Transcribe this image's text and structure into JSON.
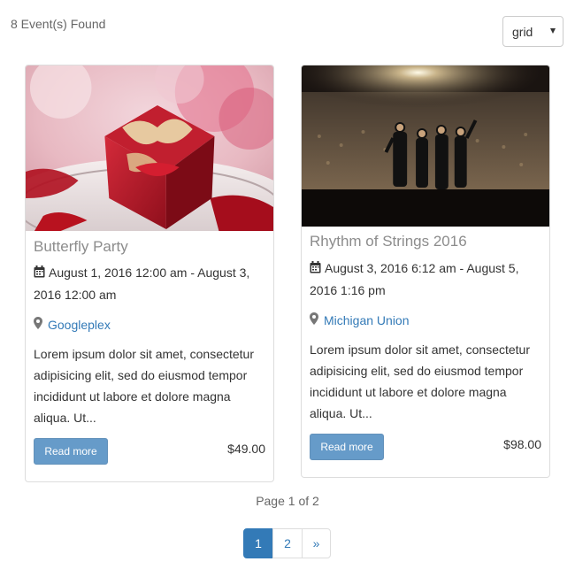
{
  "results": {
    "count_text": "8 Event(s) Found"
  },
  "view_select": {
    "value": "grid"
  },
  "events": [
    {
      "title": "Butterfly Party",
      "date": "August 1, 2016 12:00 am - August 3, 2016 12:00 am",
      "venue": "Googleplex",
      "description": "Lorem ipsum dolor sit amet, consectetur adipisicing elit, sed do eiusmod tempor incididunt ut labore et dolore magna aliqua. Ut...",
      "read_more": "Read more",
      "price": "$49.00"
    },
    {
      "title": "Rhythm of Strings 2016",
      "date": "August 3, 2016 6:12 am - August 5, 2016 1:16 pm",
      "venue": "Michigan Union",
      "description": "Lorem ipsum dolor sit amet, consectetur adipisicing elit, sed do eiusmod tempor incididunt ut labore et dolore magna aliqua. Ut...",
      "read_more": "Read more",
      "price": "$98.00"
    }
  ],
  "pagination": {
    "info": "Page 1 of 2",
    "pages": [
      "1",
      "2"
    ],
    "next": "»",
    "current": 1
  },
  "colors": {
    "link": "#337ab7",
    "button": "#337ab7",
    "title": "#8c8c8c"
  }
}
